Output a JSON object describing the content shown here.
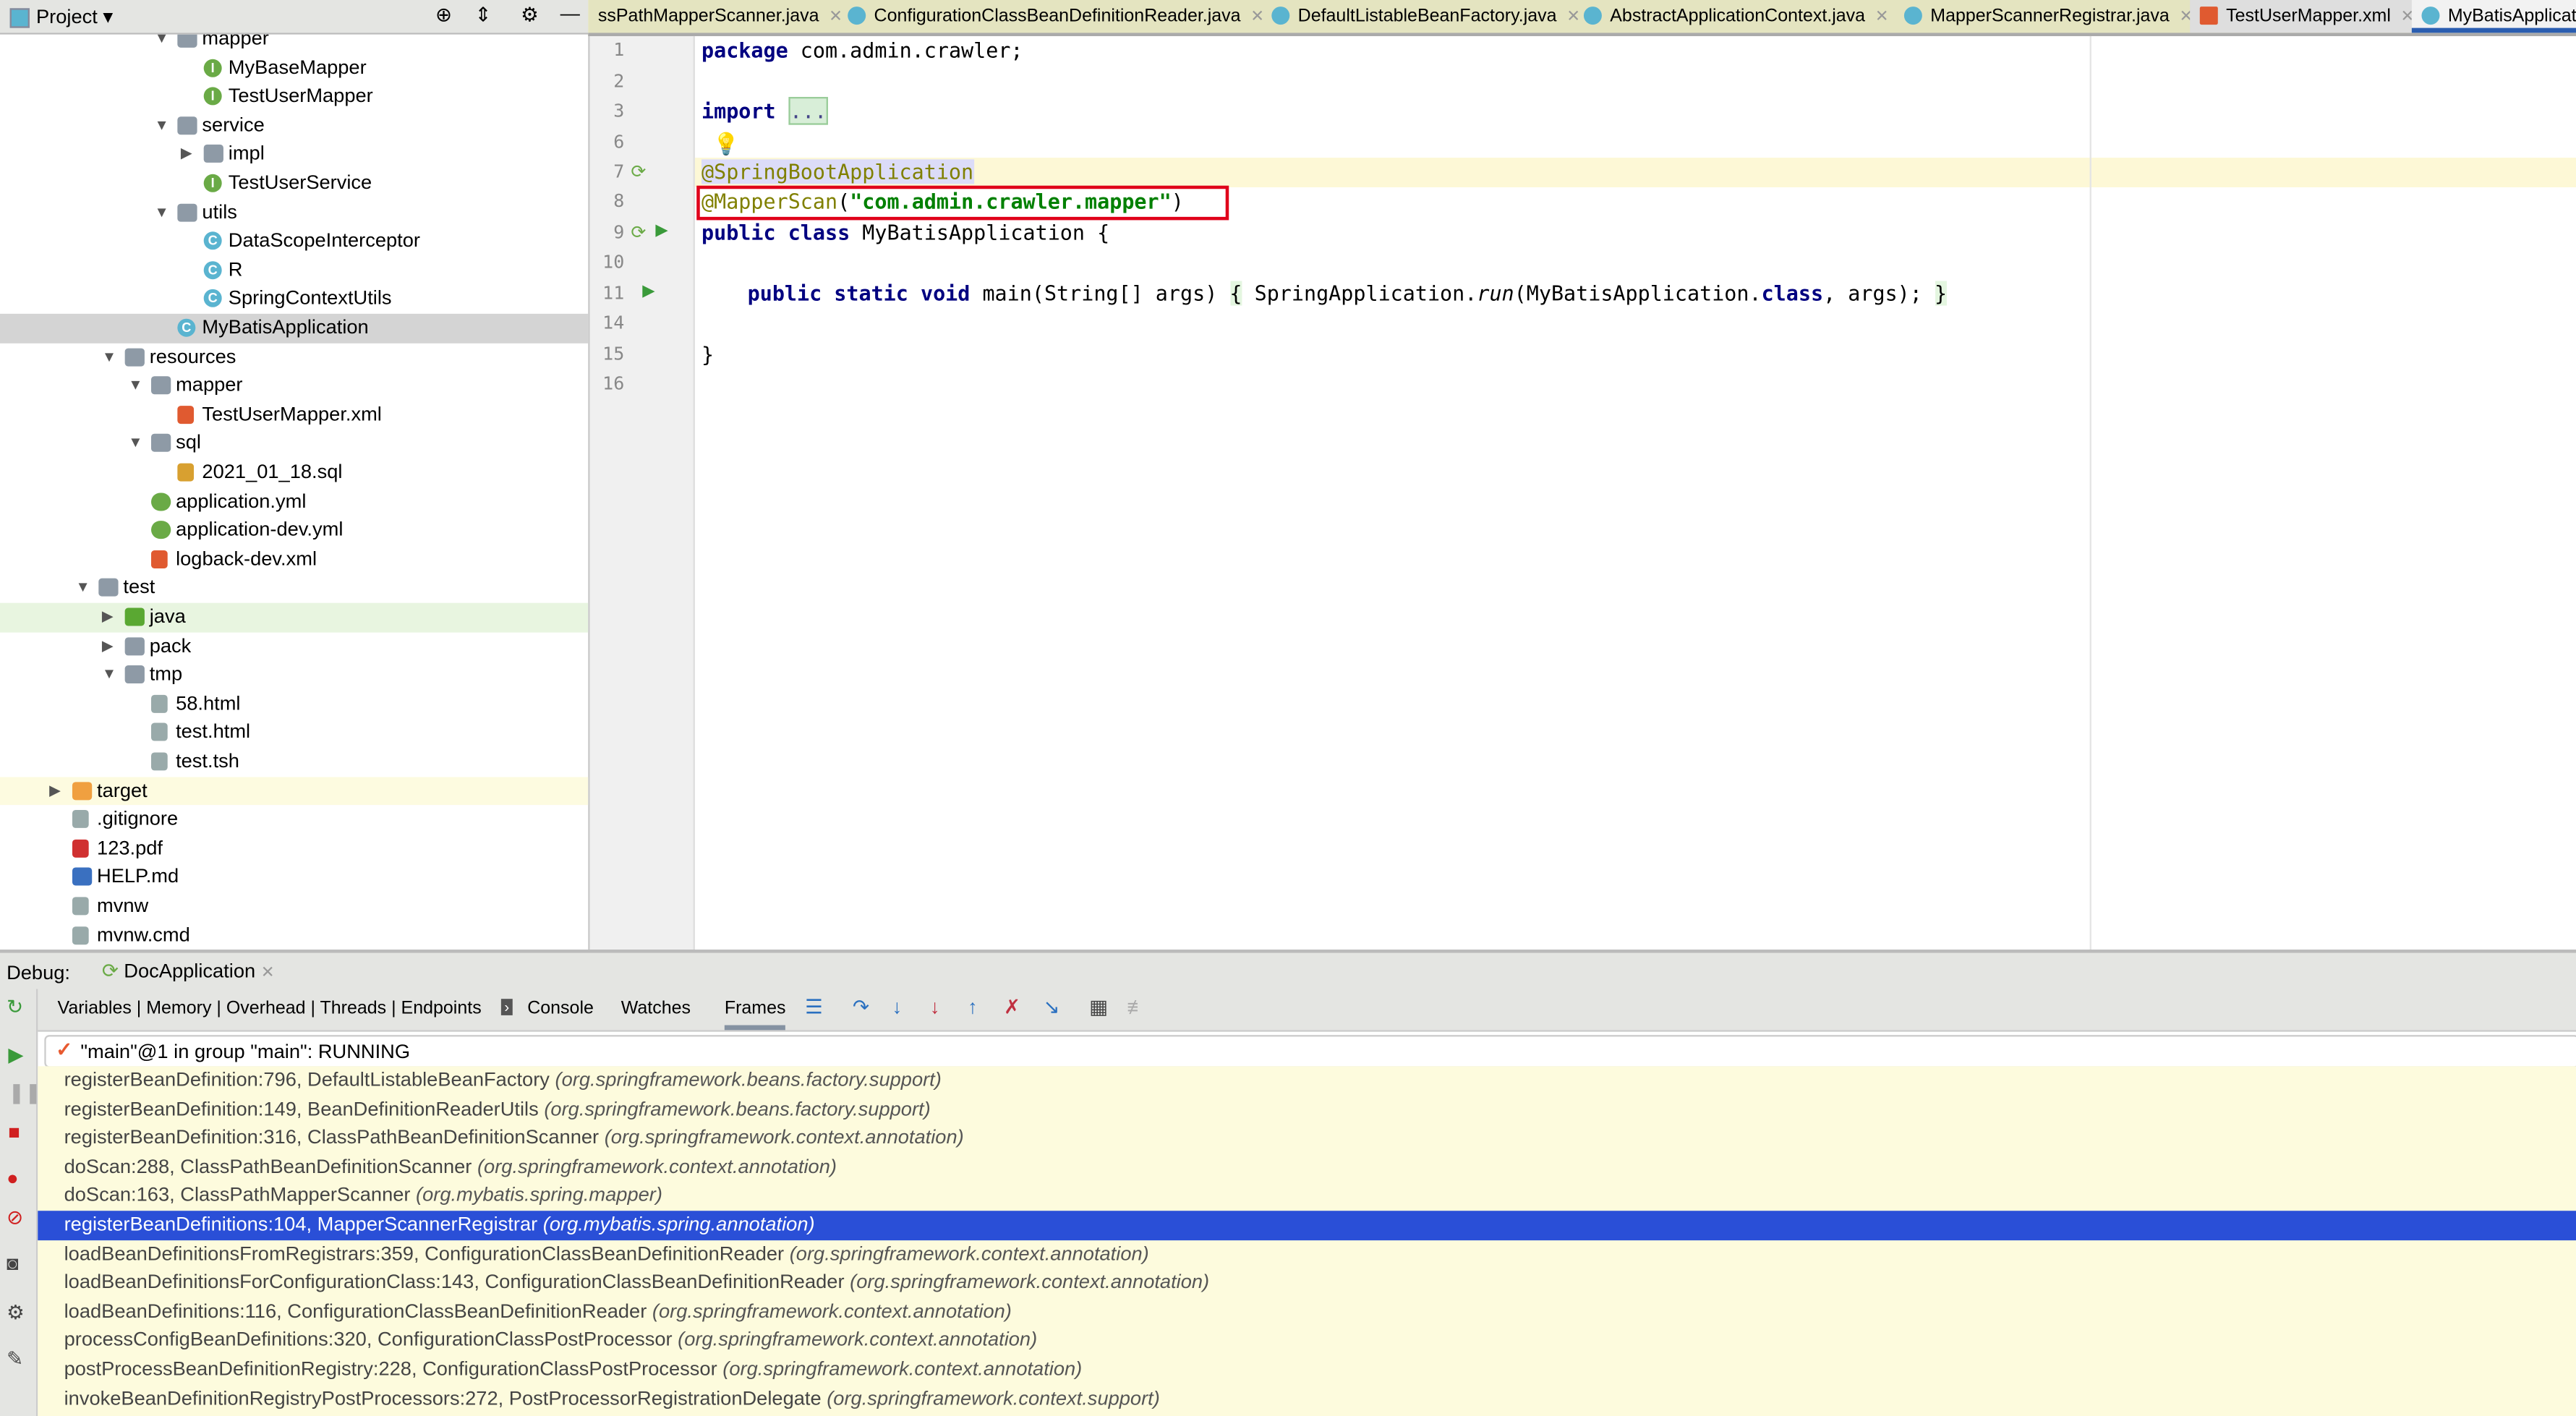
{
  "project_panel": {
    "title": "Project",
    "icons": [
      "crosshair-icon",
      "collapse-icon",
      "gear-icon",
      "minimize-icon"
    ]
  },
  "tree": [
    {
      "label": "mapper",
      "level": 6,
      "icon": "folder",
      "expanded": true
    },
    {
      "label": "MyBaseMapper",
      "level": 7,
      "icon": "iface"
    },
    {
      "label": "TestUserMapper",
      "level": 7,
      "icon": "iface"
    },
    {
      "label": "service",
      "level": 6,
      "icon": "folder",
      "expanded": true
    },
    {
      "label": "impl",
      "level": 7,
      "icon": "folder",
      "expanded": false
    },
    {
      "label": "TestUserService",
      "level": 7,
      "icon": "iface"
    },
    {
      "label": "utils",
      "level": 6,
      "icon": "folder",
      "expanded": true
    },
    {
      "label": "DataScopeInterceptor",
      "level": 7,
      "icon": "cls"
    },
    {
      "label": "R",
      "level": 7,
      "icon": "cls"
    },
    {
      "label": "SpringContextUtils",
      "level": 7,
      "icon": "cls"
    },
    {
      "label": "MyBatisApplication",
      "level": 6,
      "icon": "cls",
      "selected": true
    },
    {
      "label": "resources",
      "level": 4,
      "icon": "folder",
      "expanded": true
    },
    {
      "label": "mapper",
      "level": 5,
      "icon": "folder",
      "expanded": true
    },
    {
      "label": "TestUserMapper.xml",
      "level": 6,
      "icon": "xml"
    },
    {
      "label": "sql",
      "level": 5,
      "icon": "folder",
      "expanded": true
    },
    {
      "label": "2021_01_18.sql",
      "level": 6,
      "icon": "sql"
    },
    {
      "label": "application.yml",
      "level": 5,
      "icon": "yml"
    },
    {
      "label": "application-dev.yml",
      "level": 5,
      "icon": "yml"
    },
    {
      "label": "logback-dev.xml",
      "level": 5,
      "icon": "xml"
    },
    {
      "label": "test",
      "level": 3,
      "icon": "folder",
      "expanded": true
    },
    {
      "label": "java",
      "level": 4,
      "icon": "folder-src",
      "expanded": false,
      "highlight": "hl"
    },
    {
      "label": "pack",
      "level": 4,
      "icon": "folder",
      "expanded": false
    },
    {
      "label": "tmp",
      "level": 4,
      "icon": "folder",
      "expanded": true
    },
    {
      "label": "58.html",
      "level": 5,
      "icon": "file"
    },
    {
      "label": "test.html",
      "level": 5,
      "icon": "file"
    },
    {
      "label": "test.tsh",
      "level": 5,
      "icon": "file"
    },
    {
      "label": "target",
      "level": 2,
      "icon": "folder-orange",
      "expanded": false,
      "highlight": "ye"
    },
    {
      "label": ".gitignore",
      "level": 2,
      "icon": "file"
    },
    {
      "label": "123.pdf",
      "level": 2,
      "icon": "pdf"
    },
    {
      "label": "HELP.md",
      "level": 2,
      "icon": "md"
    },
    {
      "label": "mvnw",
      "level": 2,
      "icon": "file"
    },
    {
      "label": "mvnw.cmd",
      "level": 2,
      "icon": "file"
    }
  ],
  "tabs": [
    {
      "label": "ssPathMapperScanner.java",
      "icon": "none"
    },
    {
      "label": "ConfigurationClassBeanDefinitionReader.java",
      "icon": "class"
    },
    {
      "label": "DefaultListableBeanFactory.java",
      "icon": "class"
    },
    {
      "label": "AbstractApplicationContext.java",
      "icon": "class"
    },
    {
      "label": "MapperScannerRegistrar.java",
      "icon": "class"
    },
    {
      "label": "TestUserMapper.xml",
      "icon": "xml",
      "state": "gray"
    },
    {
      "label": "MyBatisApplicat",
      "icon": "class",
      "state": "active"
    }
  ],
  "editor": {
    "line_numbers": [
      "1",
      "2",
      "3",
      "6",
      "7",
      "8",
      "9",
      "10",
      "11",
      "14",
      "15",
      "16"
    ],
    "lines": {
      "l1_kw": "package",
      "l1_rest": " com.admin.crawler;",
      "l3_kw": "import",
      "l3_fold": "...",
      "l7": "@SpringBootApplication",
      "l8_ann": "@MapperScan",
      "l8_open": "(",
      "l8_str": "\"com.admin.crawler.mapper\"",
      "l8_close": ")",
      "l9_kw": "public class",
      "l9_rest": " MyBatisApplication {",
      "l11_kw": "public static void",
      "l11_a": " main(String[] args) ",
      "l11_b": "{",
      "l11_c": " SpringApplication.",
      "l11_run": "run",
      "l11_d": "(MyBatisApplication.",
      "l11_class": "class",
      "l11_e": ", args); ",
      "l11_f": "}",
      "l15": "}"
    }
  },
  "debug": {
    "label": "Debug:",
    "session": "DocApplication",
    "toolbar": {
      "tabs": "Variables | Memory | Overhead | Threads | Endpoints",
      "console": "Console",
      "watches": "Watches",
      "frames": "Frames"
    },
    "thread": "\"main\"@1 in group \"main\": RUNNING",
    "frames": [
      {
        "m": "registerBeanDefinition:796, DefaultListableBeanFactory",
        "p": "(org.springframework.beans.factory.support)"
      },
      {
        "m": "registerBeanDefinition:149, BeanDefinitionReaderUtils",
        "p": "(org.springframework.beans.factory.support)"
      },
      {
        "m": "registerBeanDefinition:316, ClassPathBeanDefinitionScanner",
        "p": "(org.springframework.context.annotation)"
      },
      {
        "m": "doScan:288, ClassPathBeanDefinitionScanner",
        "p": "(org.springframework.context.annotation)"
      },
      {
        "m": "doScan:163, ClassPathMapperScanner",
        "p": "(org.mybatis.spring.mapper)"
      },
      {
        "m": "registerBeanDefinitions:104, MapperScannerRegistrar",
        "p": "(org.mybatis.spring.annotation)",
        "selected": true
      },
      {
        "m": "loadBeanDefinitionsFromRegistrars:359, ConfigurationClassBeanDefinitionReader",
        "p": "(org.springframework.context.annotation)"
      },
      {
        "m": "loadBeanDefinitionsForConfigurationClass:143, ConfigurationClassBeanDefinitionReader",
        "p": "(org.springframework.context.annotation)"
      },
      {
        "m": "loadBeanDefinitions:116, ConfigurationClassBeanDefinitionReader",
        "p": "(org.springframework.context.annotation)"
      },
      {
        "m": "processConfigBeanDefinitions:320, ConfigurationClassPostProcessor",
        "p": "(org.springframework.context.annotation)"
      },
      {
        "m": "postProcessBeanDefinitionRegistry:228, ConfigurationClassPostProcessor",
        "p": "(org.springframework.context.annotation)"
      },
      {
        "m": "invokeBeanDefinitionRegistryPostProcessors:272, PostProcessorRegistrationDelegate",
        "p": "(org.springframework.context.support)"
      }
    ]
  },
  "colors": {
    "selected_frame": "#2a4fd7",
    "highlight_box": "#e0001a",
    "frames_bg": "#fdfbdd"
  }
}
